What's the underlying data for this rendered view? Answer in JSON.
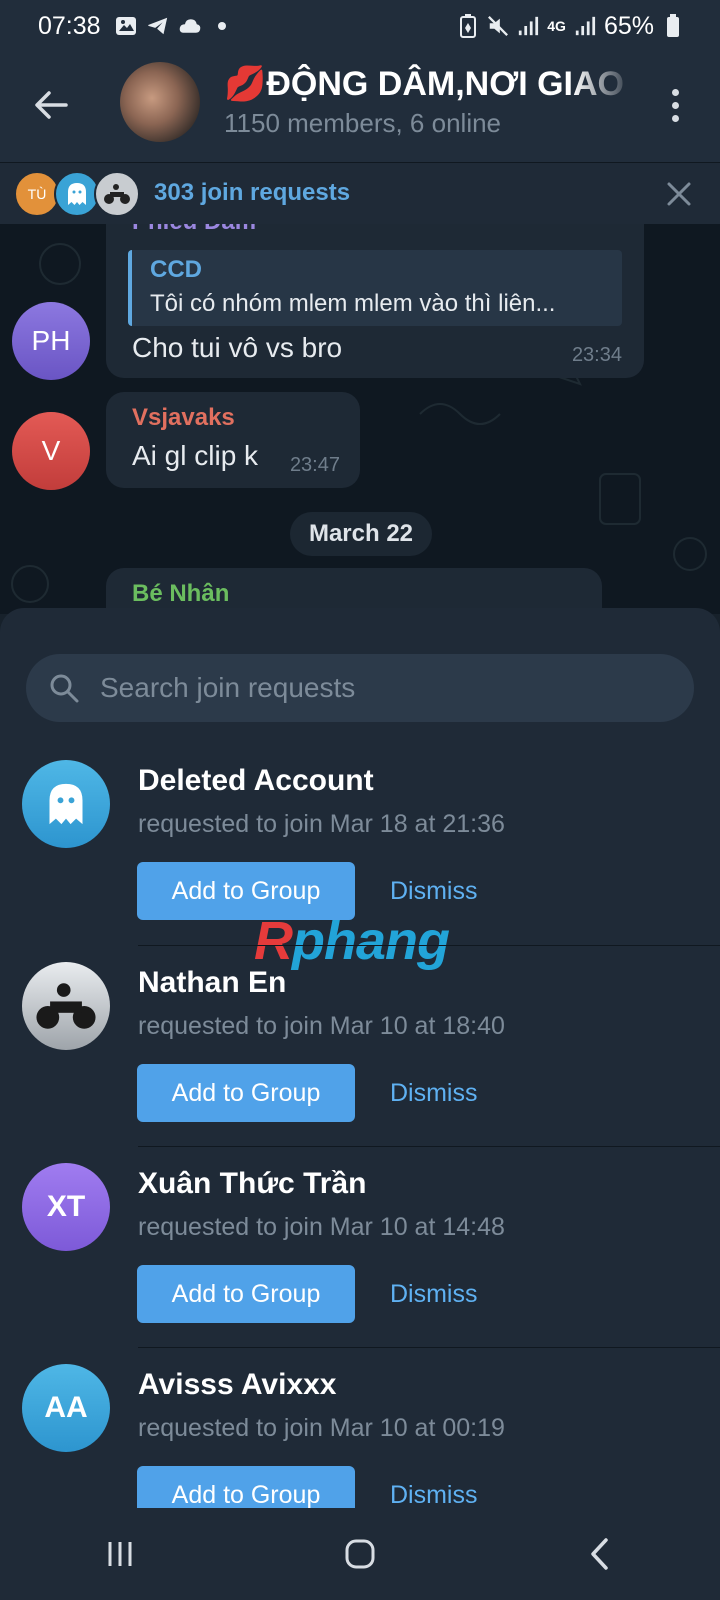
{
  "status": {
    "time": "07:38",
    "battery": "65%",
    "network": "4G"
  },
  "header": {
    "title": "💋ĐỘNG DÂM,NƠI GIAO LƯU",
    "subtitle": "1150 members, 6 online"
  },
  "join_banner": {
    "label": "303 join requests",
    "mini_avatar_initials": "TÙ"
  },
  "chat": {
    "messages": [
      {
        "sender": "Phieu Dam",
        "reply_author": "CCD",
        "reply_text": "Tôi có nhóm mlem mlem vào thì liên...",
        "text": "Cho tui vô vs bro",
        "time": "23:34",
        "avatar_initials": "PH"
      },
      {
        "sender": "Vsjavaks",
        "text": "Ai gl clip k",
        "time": "23:47",
        "avatar_initials": "V"
      }
    ],
    "date_separator": "March 22",
    "partial_sender": "Bé Nhân"
  },
  "search": {
    "placeholder": "Search join requests"
  },
  "requests": [
    {
      "name": "Deleted Account",
      "requested": "requested to join Mar 18 at 21:36",
      "initials": "",
      "add_label": "Add to Group",
      "dismiss_label": "Dismiss"
    },
    {
      "name": "Nathan En",
      "requested": "requested to join Mar 10 at 18:40",
      "initials": "",
      "add_label": "Add to Group",
      "dismiss_label": "Dismiss"
    },
    {
      "name": "Xuân Thức Trần",
      "requested": "requested to join Mar 10 at 14:48",
      "initials": "XT",
      "add_label": "Add to Group",
      "dismiss_label": "Dismiss"
    },
    {
      "name": "Avisss Avixxx",
      "requested": "requested to join Mar 10 at 00:19",
      "initials": "AA",
      "add_label": "Add to Group",
      "dismiss_label": "Dismiss"
    }
  ],
  "watermark": {
    "part1": "R",
    "part2": "phang"
  },
  "colors": {
    "accent": "#50a2e9",
    "background": "#17212b",
    "link": "#5fb1f2"
  }
}
